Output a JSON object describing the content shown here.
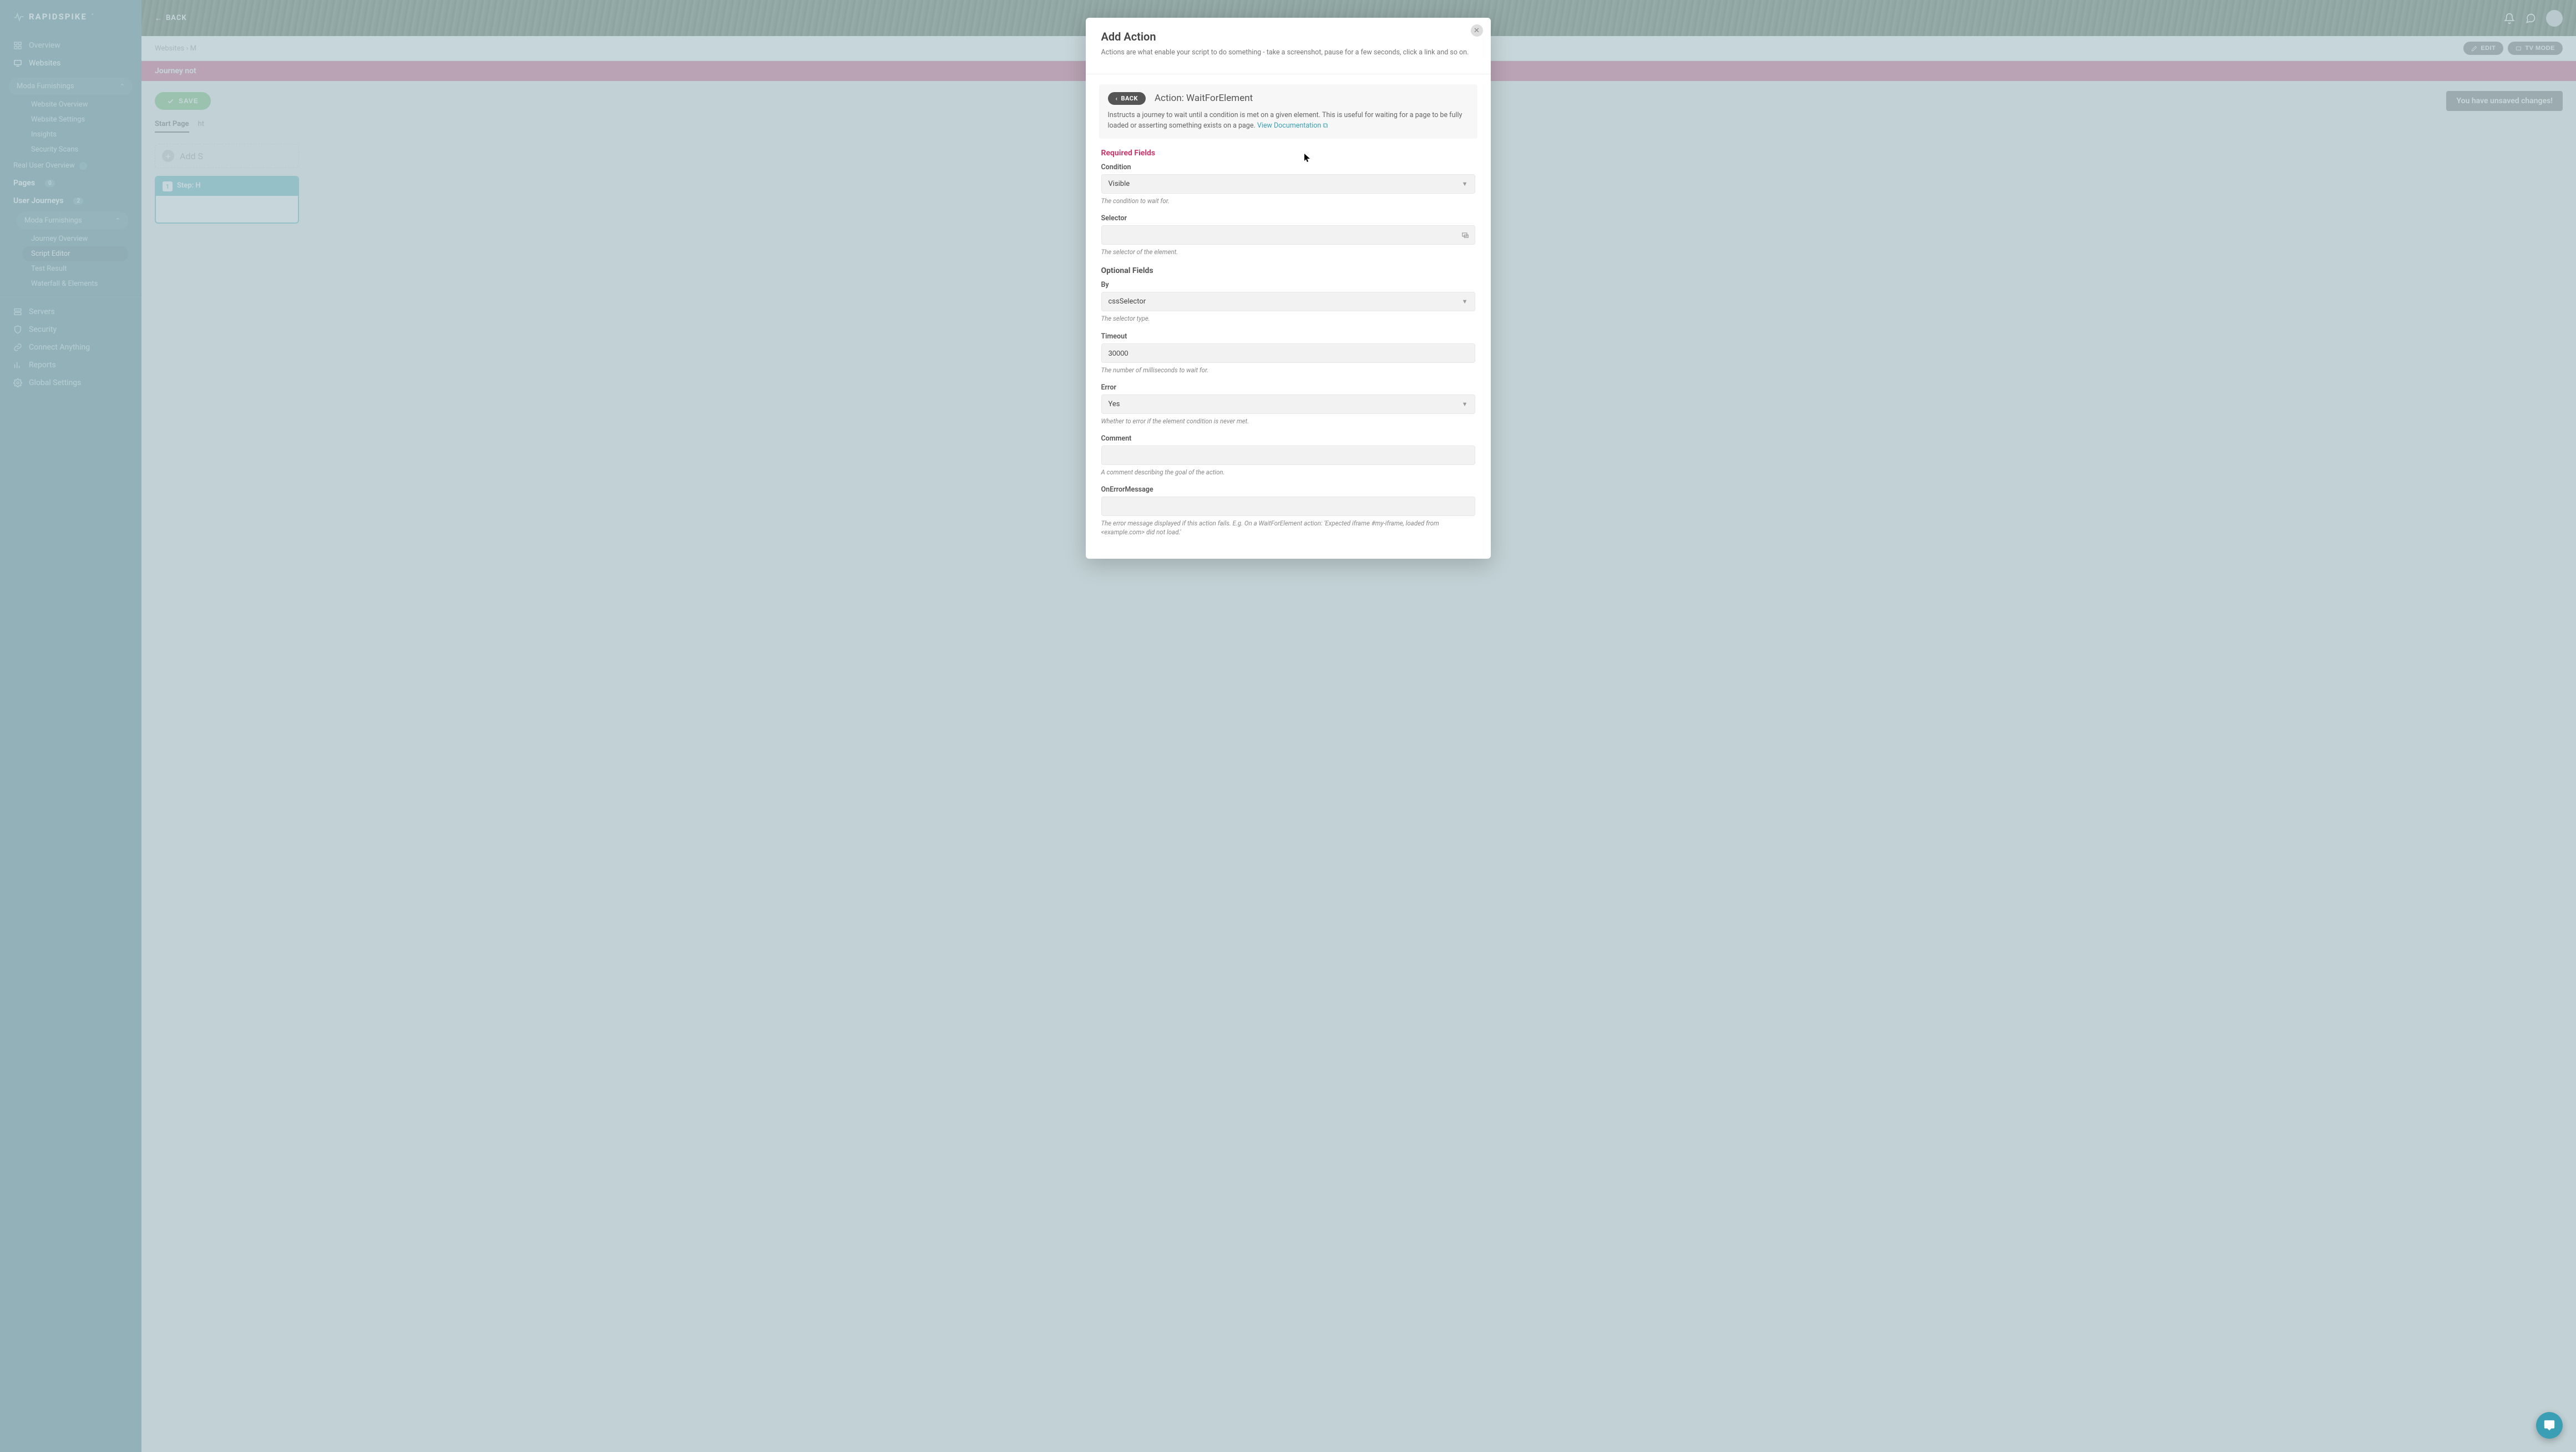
{
  "brand": "RAPIDSPIKE",
  "sidebar": {
    "overview": "Overview",
    "websites": "Websites",
    "site_group": "Moda Furnishings",
    "site_items": [
      "Website Overview",
      "Website Settings",
      "Insights",
      "Security Scans"
    ],
    "real_user": "Real User Overview",
    "pages_label": "Pages",
    "pages_count": "0",
    "journeys_label": "User Journeys",
    "journeys_count": "2",
    "journey_group": "Moda Furnishings",
    "journey_items": [
      "Journey Overview",
      "Script Editor",
      "Test Result",
      "Waterfall & Elements"
    ],
    "servers": "Servers",
    "security": "Security",
    "connect": "Connect Anything",
    "reports": "Reports",
    "settings": "Global Settings"
  },
  "header": {
    "back": "BACK",
    "edit": "EDIT",
    "tv_mode": "TV MODE"
  },
  "breadcrumb": {
    "root": "Websites",
    "rest": "M"
  },
  "banner": "Journey not",
  "toolbar": {
    "save": "SAVE",
    "unsaved": "You have unsaved changes!"
  },
  "tabs": {
    "start_page": "Start Page",
    "url_prefix": "ht"
  },
  "add_step": "Add S",
  "step": {
    "num": "1",
    "label": "Step: H"
  },
  "modal": {
    "title": "Add Action",
    "subtitle": "Actions are what enable your script to do something - take a screenshot, pause for a few seconds, click a link and so on.",
    "back": "BACK",
    "action_title": "Action: WaitForElement",
    "action_desc": "Instructs a journey to wait until a condition is met on a given element. This is useful for waiting for a page to be fully loaded or asserting something exists on a page. ",
    "view_doc": "View Documentation",
    "required_heading": "Required Fields",
    "optional_heading": "Optional Fields",
    "fields": {
      "condition": {
        "label": "Condition",
        "value": "Visible",
        "hint": "The condition to wait for."
      },
      "selector": {
        "label": "Selector",
        "value": "",
        "hint": "The selector of the element."
      },
      "by": {
        "label": "By",
        "value": "cssSelector",
        "hint": "The selector type."
      },
      "timeout": {
        "label": "Timeout",
        "value": "30000",
        "hint": "The number of milliseconds to wait for."
      },
      "error": {
        "label": "Error",
        "value": "Yes",
        "hint": "Whether to error if the element condition is never met."
      },
      "comment": {
        "label": "Comment",
        "value": "",
        "hint": "A comment describing the goal of the action."
      },
      "onerror": {
        "label": "OnErrorMessage",
        "value": "",
        "hint": "The error message displayed if this action fails. E.g. On a WaitForElement action: 'Expected iframe #my-iframe, loaded from <example.com> did not load.'"
      }
    }
  }
}
